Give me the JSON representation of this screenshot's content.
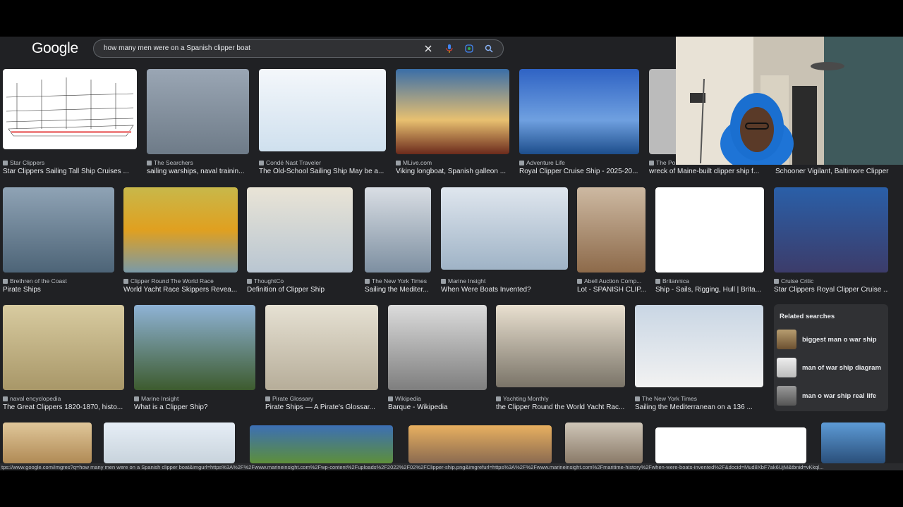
{
  "app": {
    "logo": "Google",
    "search_query": "how many men were on a Spanish clipper boat",
    "icons": {
      "clear": "close-icon",
      "voice": "microphone-icon",
      "lens": "lens-icon",
      "search": "search-icon"
    }
  },
  "rows": [
    [
      {
        "source": "Star Clippers",
        "title": "Star Clippers Sailing Tall Ship Cruises ..."
      },
      {
        "source": "The Searchers",
        "title": "sailing warships, naval trainin..."
      },
      {
        "source": "Condé Nast Traveler",
        "title": "The Old-School Sailing Ship May be a..."
      },
      {
        "source": "MLive.com",
        "title": "Viking longboat, Spanish galleon ..."
      },
      {
        "source": "Adventure Life",
        "title": "Royal Clipper Cruise Ship - 2025-20..."
      },
      {
        "source": "The Po",
        "title": "wreck of Maine-built clipper ship f..."
      },
      {
        "source": "",
        "title": "Schooner Vigilant, Baltimore Clipper"
      }
    ],
    [
      {
        "source": "Brethren of the Coast",
        "title": "Pirate Ships"
      },
      {
        "source": "Clipper Round The World Race",
        "title": "World Yacht Race Skippers Revea..."
      },
      {
        "source": "ThoughtCo",
        "title": "Definition of Clipper Ship"
      },
      {
        "source": "The New York Times",
        "title": "Sailing the Mediter..."
      },
      {
        "source": "Marine Insight",
        "title": "When Were Boats Invented?"
      },
      {
        "source": "Abell Auction Comp...",
        "title": "Lot - SPANISH CLIP..."
      },
      {
        "source": "Britannica",
        "title": "Ship - Sails, Rigging, Hull | Brita..."
      },
      {
        "source": "Cruise Critic",
        "title": "Star Clippers Royal Clipper Cruise ..."
      }
    ],
    [
      {
        "source": "naval encyclopedia",
        "title": "The Great Clippers 1820-1870, histo..."
      },
      {
        "source": "Marine Insight",
        "title": "What is a Clipper Ship?"
      },
      {
        "source": "Pirate Glossary",
        "title": "Pirate Ships — A Pirate's Glossar..."
      },
      {
        "source": "Wikipedia",
        "title": "Barque - Wikipedia"
      },
      {
        "source": "Yachting Monthly",
        "title": "the Clipper Round the World Yacht Rac..."
      },
      {
        "source": "The New York Times",
        "title": "Sailing the Mediterranean on a 136 ..."
      }
    ]
  ],
  "related": {
    "heading": "Related searches",
    "items": [
      "biggest man o war ship",
      "man of war ship diagram",
      "man o war ship real life"
    ]
  },
  "status_url": "tps://www.google.com/imgres?q=how many men were on a Spanish clipper boat&imgurl=https%3A%2F%2Fwww.marineinsight.com%2Fwp-content%2Fuploads%2F2022%2F02%2FClipper-ship.png&imgrefurl=https%3A%2F%2Fwww.marineinsight.com%2Fmaritime-history%2Fwhen-were-boats-invented%2F&docid=Mud8XbF7ak6UjM&tbnid=vKkql..."
}
